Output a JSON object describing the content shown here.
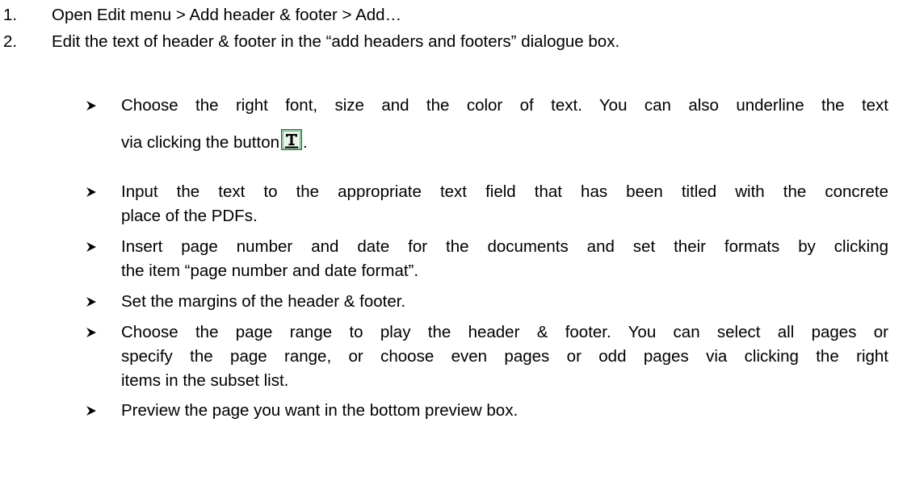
{
  "steps": [
    {
      "num": "1.",
      "text": "Open Edit menu > Add header & footer > Add…"
    },
    {
      "num": "2.",
      "text": "Edit the text of header & footer in the “add headers and footers” dialogue box."
    }
  ],
  "bullets": {
    "b1": {
      "line1": "Choose the right font, size and the color of text. You can also underline the text",
      "line2_before": "via clicking the button",
      "line2_after": "."
    },
    "b2": {
      "line1": "Input the text to the appropriate text field that has been titled with the concrete",
      "line2": "place of the PDFs."
    },
    "b3": {
      "line1": "Insert page number and date for the documents and set their formats by clicking",
      "line2": "the item “page number and date format”."
    },
    "b4": {
      "line1": "Set the margins of the header & footer."
    },
    "b5": {
      "line1": "Choose the page range to play the header & footer. You can select all pages or",
      "line2": "specify the page range, or choose even pages or odd pages via clicking the right",
      "line3": "items in the subset list."
    },
    "b6": {
      "line1": "Preview the page you want in the bottom preview box."
    }
  },
  "icons": {
    "bullet": "arrow-bullet-icon",
    "underline_button": "underline-text-button-icon"
  },
  "colors": {
    "text": "#000000",
    "icon_border": "#1f6f3a",
    "icon_fill": "#cfe8cf"
  }
}
